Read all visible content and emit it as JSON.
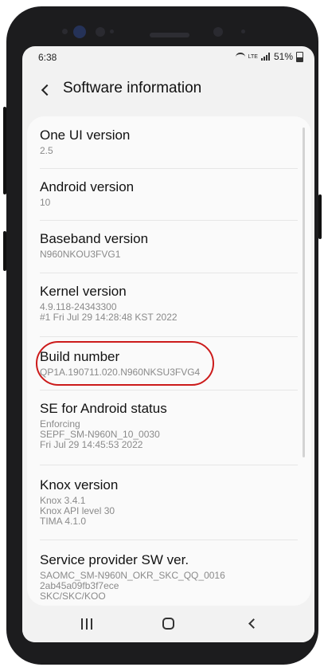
{
  "status_bar": {
    "time": "6:38",
    "network_label": "LTE",
    "battery_percent": "51%"
  },
  "header": {
    "title": "Software information"
  },
  "items": [
    {
      "label": "One UI version",
      "value": "2.5"
    },
    {
      "label": "Android version",
      "value": "10"
    },
    {
      "label": "Baseband version",
      "value": "N960NKOU3FVG1"
    },
    {
      "label": "Kernel version",
      "value": "4.9.118-24343300\n#1 Fri Jul 29 14:28:48 KST 2022"
    },
    {
      "label": "Build number",
      "value": "QP1A.190711.020.N960NKSU3FVG4"
    },
    {
      "label": "SE for Android status",
      "value": "Enforcing\nSEPF_SM-N960N_10_0030\nFri Jul 29 14:45:53 2022"
    },
    {
      "label": "Knox version",
      "value": "Knox 3.4.1\nKnox API level 30\nTIMA 4.1.0"
    },
    {
      "label": "Service provider SW ver.",
      "value": "SAOMC_SM-N960N_OKR_SKC_QQ_0016\n2ab45a09fb3f7ece\nSKC/SKC/KOO"
    }
  ],
  "highlight": {
    "target": "Build number",
    "color": "#cc1b1b"
  },
  "nav_bar": {
    "icons": [
      "recent-apps-icon",
      "home-icon",
      "back-icon"
    ]
  }
}
